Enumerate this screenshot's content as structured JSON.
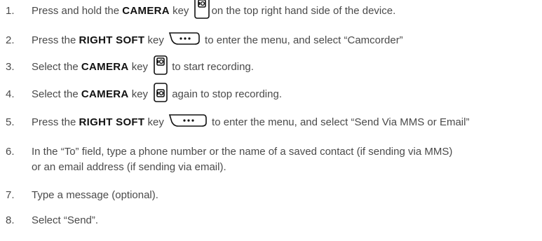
{
  "steps": [
    {
      "number": "1.",
      "before": "Press and hold the ",
      "key": "CAMERA",
      "middle": " key ",
      "icon": "camera-key-icon",
      "after": "on the top right hand side of the device."
    },
    {
      "number": "2.",
      "before": "Press the ",
      "key": "RIGHT SOFT",
      "middle": " key ",
      "icon": "right-soft-key-icon",
      "icon_text": "•••",
      "after": "to enter the menu, and select “Camcorder”"
    },
    {
      "number": "3.",
      "before": "Select the ",
      "key": "CAMERA",
      "middle": " key ",
      "icon": "camera-key-icon",
      "after": "to start recording."
    },
    {
      "number": "4.",
      "before": "Select the ",
      "key": "CAMERA",
      "middle": " key ",
      "icon": "camera-key-icon",
      "after": "again to stop recording."
    },
    {
      "number": "5.",
      "before": "Press the ",
      "key": "RIGHT SOFT",
      "middle": " key ",
      "icon": "right-soft-key-icon",
      "icon_text": "•••",
      "after": "to enter the menu, and select “Send Via MMS or Email”"
    },
    {
      "number": "6.",
      "line1": "In the “To” field, type a phone number or the name of a saved contact (if sending via MMS)",
      "line2": "or an email address (if sending via email)."
    },
    {
      "number": "7.",
      "text": "Type a message (optional)."
    },
    {
      "number": "8.",
      "text": "Select “Send”."
    }
  ],
  "colors": {
    "text": "#4a4a4a",
    "key_text": "#111111",
    "icon_stroke": "#111111"
  }
}
